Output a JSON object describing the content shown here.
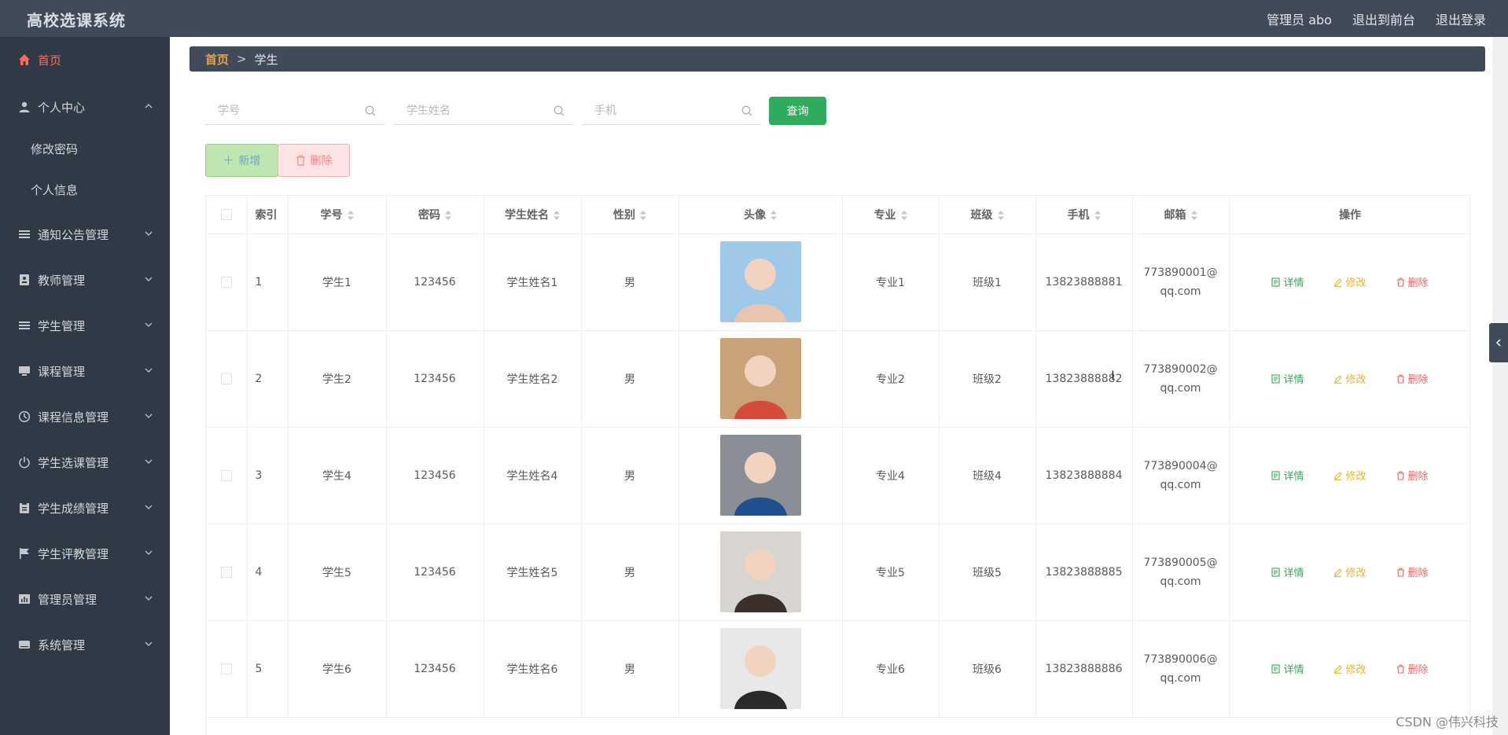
{
  "app": {
    "title": "高校选课系统"
  },
  "header": {
    "user": "管理员 abo",
    "to_front": "退出到前台",
    "logout": "退出登录"
  },
  "sidebar": {
    "items": [
      {
        "label": "首页",
        "icon": "home-icon",
        "active": true
      },
      {
        "label": "个人中心",
        "icon": "user-icon",
        "expanded": true,
        "children": [
          "修改密码",
          "个人信息"
        ]
      },
      {
        "label": "通知公告管理",
        "icon": "list-icon"
      },
      {
        "label": "教师管理",
        "icon": "id-card-icon"
      },
      {
        "label": "学生管理",
        "icon": "list-icon"
      },
      {
        "label": "课程管理",
        "icon": "monitor-icon"
      },
      {
        "label": "课程信息管理",
        "icon": "clock-icon"
      },
      {
        "label": "学生选课管理",
        "icon": "power-icon"
      },
      {
        "label": "学生成绩管理",
        "icon": "clipboard-icon"
      },
      {
        "label": "学生评教管理",
        "icon": "flag-icon"
      },
      {
        "label": "管理员管理",
        "icon": "chart-icon"
      },
      {
        "label": "系统管理",
        "icon": "drive-icon"
      }
    ]
  },
  "breadcrumb": {
    "home": "首页",
    "separator": ">",
    "current": "学生"
  },
  "search": {
    "student_no_placeholder": "学号",
    "student_name_placeholder": "学生姓名",
    "phone_placeholder": "手机",
    "query_label": "查询"
  },
  "toolbar": {
    "add_label": "新增",
    "delete_label": "删除"
  },
  "table": {
    "columns": [
      "索引",
      "学号",
      "密码",
      "学生姓名",
      "性别",
      "头像",
      "专业",
      "班级",
      "手机",
      "邮箱",
      "操作"
    ],
    "actions": {
      "detail": "详情",
      "edit": "修改",
      "delete": "删除"
    },
    "rows": [
      {
        "index": "1",
        "student_no": "学生1",
        "password": "123456",
        "name": "学生姓名1",
        "gender": "男",
        "major": "专业1",
        "class": "班级1",
        "phone": "13823888881",
        "email_1": "773890001@",
        "email_2": "qq.com",
        "avatar_colors": [
          "#9ec9e8",
          "#e9c4b0"
        ]
      },
      {
        "index": "2",
        "student_no": "学生2",
        "password": "123456",
        "name": "学生姓名2",
        "gender": "男",
        "major": "专业2",
        "class": "班级2",
        "phone": "13823888882",
        "email_1": "773890002@",
        "email_2": "qq.com",
        "avatar_colors": [
          "#c9a27a",
          "#d64a3a"
        ]
      },
      {
        "index": "3",
        "student_no": "学生4",
        "password": "123456",
        "name": "学生姓名4",
        "gender": "男",
        "major": "专业4",
        "class": "班级4",
        "phone": "13823888884",
        "email_1": "773890004@",
        "email_2": "qq.com",
        "avatar_colors": [
          "#8a8f96",
          "#1f4f8f"
        ]
      },
      {
        "index": "4",
        "student_no": "学生5",
        "password": "123456",
        "name": "学生姓名5",
        "gender": "男",
        "major": "专业5",
        "class": "班级5",
        "phone": "13823888885",
        "email_1": "773890005@",
        "email_2": "qq.com",
        "avatar_colors": [
          "#d8d4d0",
          "#3a2f2a"
        ]
      },
      {
        "index": "5",
        "student_no": "学生6",
        "password": "123456",
        "name": "学生姓名6",
        "gender": "男",
        "major": "专业6",
        "class": "班级6",
        "phone": "13823888886",
        "email_1": "773890006@",
        "email_2": "qq.com",
        "avatar_colors": [
          "#e8e8e8",
          "#2a2a2a"
        ]
      }
    ]
  },
  "watermark": "CSDN @伟兴科技"
}
